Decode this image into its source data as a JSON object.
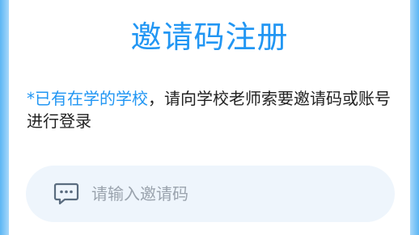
{
  "page": {
    "title": "邀请码注册"
  },
  "notice": {
    "highlight": "*已有在学的学校",
    "rest": "，请向学校老师索要邀请码或账号进行登录"
  },
  "code_field": {
    "placeholder": "请输入邀请码",
    "value": "",
    "icon": "chat-bubble-icon"
  },
  "colors": {
    "accent": "#2196f3",
    "field_bg": "#eef5fc",
    "edge": "#5cb6f4",
    "text": "#222222",
    "placeholder": "#9aa3ad"
  }
}
